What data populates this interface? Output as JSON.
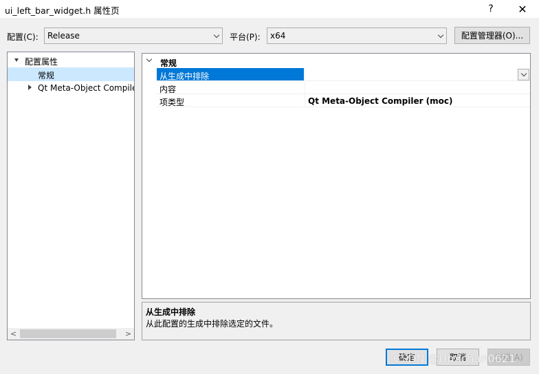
{
  "window": {
    "title": "ui_left_bar_widget.h 属性页",
    "help_label": "?",
    "close_label": "✕"
  },
  "toolbar": {
    "config_label": "配置(C):",
    "config_value": "Release",
    "platform_label": "平台(P):",
    "platform_value": "x64",
    "config_manager_label": "配置管理器(O)..."
  },
  "tree": {
    "items": [
      {
        "label": "配置属性"
      },
      {
        "label": "常规"
      },
      {
        "label": "Qt Meta-Object Compiler"
      }
    ],
    "scroll_left": "<",
    "scroll_right": ">"
  },
  "grid": {
    "category": "常规",
    "rows": [
      {
        "name": "从生成中排除",
        "value": ""
      },
      {
        "name": "内容",
        "value": ""
      },
      {
        "name": "项类型",
        "value": "Qt Meta-Object Compiler (moc)"
      }
    ]
  },
  "description": {
    "title": "从生成中排除",
    "text": "从此配置的生成中排除选定的文件。"
  },
  "buttons": {
    "ok": "确定",
    "cancel": "取消",
    "apply": "应用(A)"
  },
  "watermark": "CSDN @Umichan0621",
  "colors": {
    "selection": "#0078d7",
    "tree_selection": "#cce8ff",
    "disabled_text": "#a0a0a0"
  }
}
